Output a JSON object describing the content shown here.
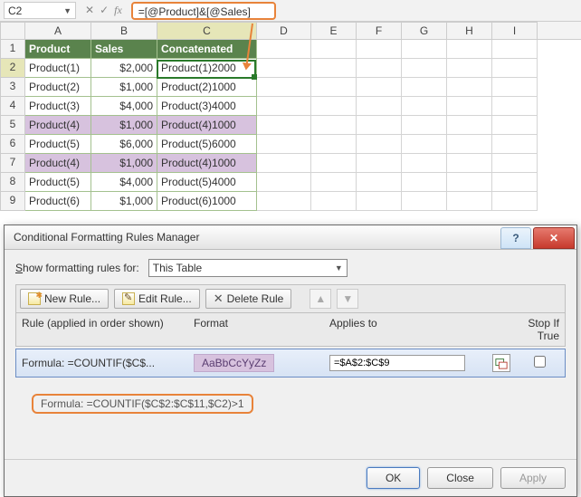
{
  "formula_bar": {
    "name_box": "C2",
    "formula": "=[@Product]&[@Sales]"
  },
  "columns": [
    "",
    "A",
    "B",
    "C",
    "D",
    "E",
    "F",
    "G",
    "H",
    "I"
  ],
  "headers": {
    "product": "Product",
    "sales": "Sales",
    "concat": "Concatenated"
  },
  "rows": [
    {
      "r": "1"
    },
    {
      "r": "2",
      "product": "Product(1)",
      "sales": "$2,000",
      "concat": "Product(1)2000",
      "hl": false
    },
    {
      "r": "3",
      "product": "Product(2)",
      "sales": "$1,000",
      "concat": "Product(2)1000",
      "hl": false
    },
    {
      "r": "4",
      "product": "Product(3)",
      "sales": "$4,000",
      "concat": "Product(3)4000",
      "hl": false
    },
    {
      "r": "5",
      "product": "Product(4)",
      "sales": "$1,000",
      "concat": "Product(4)1000",
      "hl": true
    },
    {
      "r": "6",
      "product": "Product(5)",
      "sales": "$6,000",
      "concat": "Product(5)6000",
      "hl": false
    },
    {
      "r": "7",
      "product": "Product(4)",
      "sales": "$1,000",
      "concat": "Product(4)1000",
      "hl": true
    },
    {
      "r": "8",
      "product": "Product(5)",
      "sales": "$4,000",
      "concat": "Product(5)4000",
      "hl": false
    },
    {
      "r": "9",
      "product": "Product(6)",
      "sales": "$1,000",
      "concat": "Product(6)1000",
      "hl": false
    }
  ],
  "dialog": {
    "title": "Conditional Formatting Rules Manager",
    "show_label_pre": "S",
    "show_label_post": "how formatting rules for:",
    "scope": "This Table",
    "btn_new": "New Rule...",
    "btn_edit": "Edit Rule...",
    "btn_delete": "Delete Rule",
    "col_rule": "Rule (applied in order shown)",
    "col_format": "Format",
    "col_applies": "Applies to",
    "col_stop": "Stop If True",
    "rule_text": "Formula: =COUNTIF($C$...",
    "sample": "AaBbCcYyZz",
    "applies_to": "=$A$2:$C$9",
    "formula_full": "Formula: =COUNTIF($C$2:$C$11,$C2)>1",
    "btn_ok": "OK",
    "btn_close": "Close",
    "btn_apply": "Apply"
  }
}
